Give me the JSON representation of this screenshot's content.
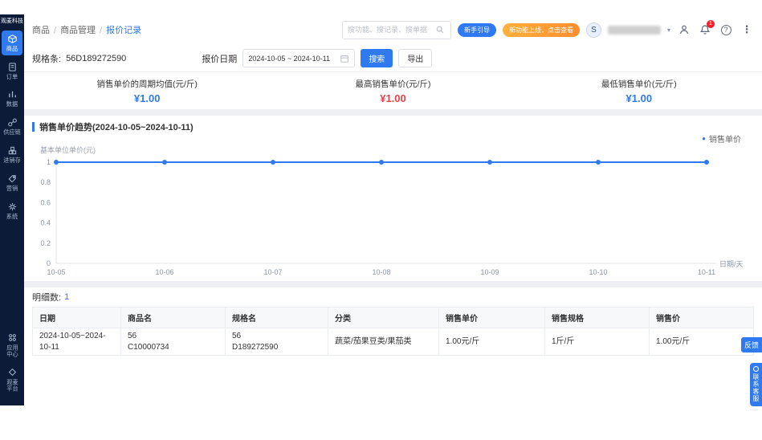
{
  "colors": {
    "accent": "#2f7af0",
    "danger": "#e8414b",
    "sidebar_bg": "#0c1c38",
    "promo": "#ff8d2e"
  },
  "icons": {
    "help": "?",
    "more": "⋮",
    "chevron": "▾",
    "legend_dot": "●"
  },
  "sidebar": {
    "logo": "观麦科技",
    "items": [
      {
        "label": "商品",
        "active": true
      },
      {
        "label": "订单"
      },
      {
        "label": "数据"
      },
      {
        "label": "供应链"
      },
      {
        "label": "进销存"
      },
      {
        "label": "营销"
      },
      {
        "label": "系统"
      }
    ],
    "bottom_items": [
      {
        "label": "应用中心"
      },
      {
        "label": "观麦平台"
      }
    ]
  },
  "header": {
    "breadcrumb": [
      {
        "label": "商品"
      },
      {
        "label": "商品管理"
      },
      {
        "label": "报价记录",
        "current": true
      }
    ],
    "search_placeholder": "搜功能、搜记录、搜单据",
    "guide_pill": "新手引导",
    "promo_pill": "新功能上线，点击查看",
    "avatar_letter": "S",
    "notification_count": "1"
  },
  "filters": {
    "spec_label": "规格条:",
    "spec_value": "56D189272590",
    "date_label": "报价日期",
    "date_value": "2024-10-05 ~ 2024-10-11",
    "search_button": "搜索",
    "export_button": "导出"
  },
  "stats": [
    {
      "label": "销售单价的周期均值(元/斤)",
      "value": "¥1.00",
      "tone": "blue"
    },
    {
      "label": "最高销售单价(元/斤)",
      "value": "¥1.00",
      "tone": "red"
    },
    {
      "label": "最低销售单价(元/斤)",
      "value": "¥1.00",
      "tone": "blue"
    }
  ],
  "chart_data": {
    "type": "line",
    "title": "销售单价趋势(2024-10-05~2024-10-11)",
    "x": [
      "10-05",
      "10-06",
      "10-07",
      "10-08",
      "10-09",
      "10-10",
      "10-11"
    ],
    "series": [
      {
        "name": "销售单价",
        "values": [
          1,
          1,
          1,
          1,
          1,
          1,
          1
        ],
        "color": "#2f7af0"
      }
    ],
    "ylabel": "基本单位单价(元)",
    "xlabel": "日期/天",
    "ylim": [
      0,
      1
    ],
    "yticks": [
      1,
      0.8,
      0.6,
      0.4,
      0.2,
      0
    ],
    "legend_position": "top-right",
    "grid": false,
    "markers": true
  },
  "detail": {
    "label": "明细数:",
    "count": "1"
  },
  "table": {
    "headers": [
      "日期",
      "商品名",
      "规格名",
      "分类",
      "销售单价",
      "销售规格",
      "销售价"
    ],
    "rows": [
      {
        "cells": [
          "2024-10-05~2024-10-11",
          "56\nC10000734",
          "56\nD189272590",
          "蔬菜/茄果豆类/果茄类",
          "1.00元/斤",
          "1斤/斤",
          "1.00元/斤"
        ]
      }
    ]
  },
  "floating": {
    "feedback": "反馈",
    "service": "联系客服"
  }
}
